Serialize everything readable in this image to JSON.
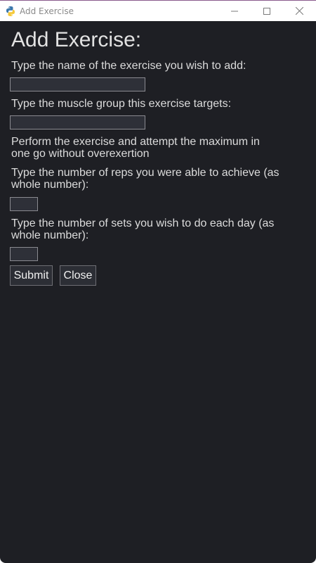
{
  "window": {
    "title": "Add Exercise"
  },
  "icons": {
    "app": "python-icon",
    "minimize": "minimize-icon",
    "maximize": "maximize-icon",
    "close": "close-icon"
  },
  "form": {
    "heading": "Add Exercise:",
    "name_label": "Type the name of the exercise you wish to add:",
    "name_value": "",
    "muscle_label": "Type the muscle group this exercise targets:",
    "muscle_value": "",
    "instruction_line1": "Perform the exercise and attempt the maximum in",
    "instruction_line2": "one go without overexertion",
    "reps_label_line1": "Type the number of reps you were able to achieve (as",
    "reps_label_line2": "whole number):",
    "reps_value": "",
    "sets_label_line1": "Type the number of sets you wish to do each day (as",
    "sets_label_line2": "whole number):",
    "sets_value": "",
    "submit_label": "Submit",
    "close_label": "Close"
  },
  "colors": {
    "background": "#1e1f24",
    "input_background": "#2e3038",
    "text": "#dcdcdc",
    "titlebar": "#ffffff"
  }
}
